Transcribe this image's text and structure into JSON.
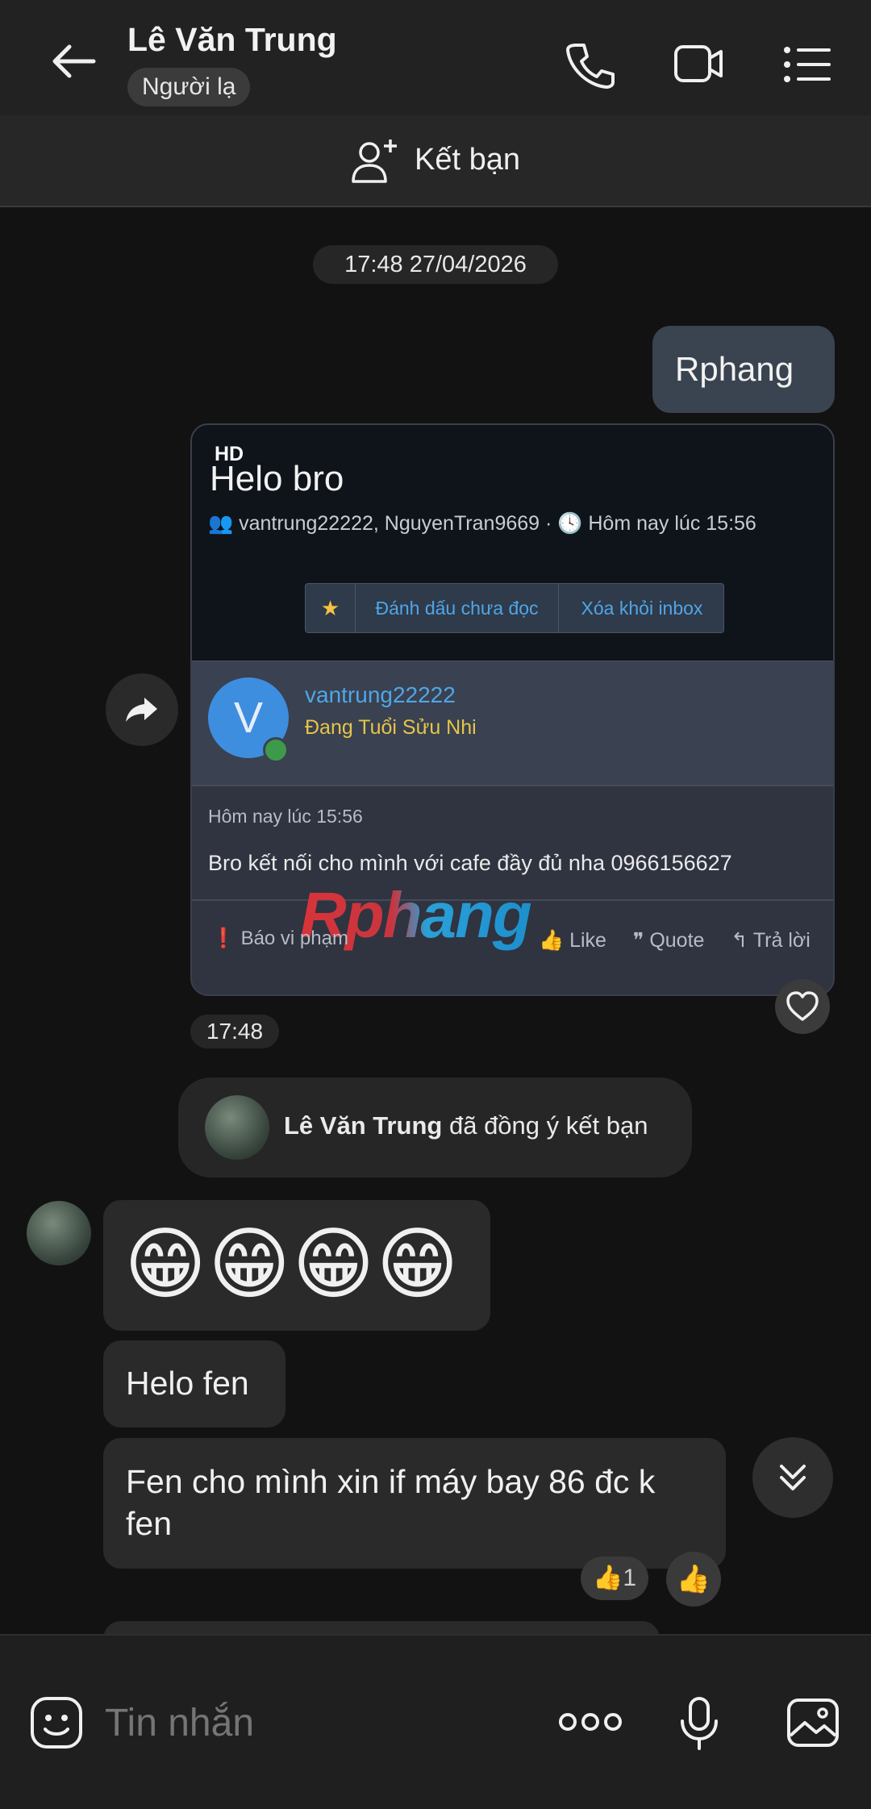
{
  "header": {
    "contact_name": "Lê Văn Trung",
    "badge": "Người lạ",
    "icons": [
      "back-arrow-icon",
      "phone-icon",
      "video-call-icon",
      "list-menu-icon"
    ]
  },
  "add_friend": {
    "label": "Kết bạn"
  },
  "timestamp_top": "17:48 27/04/2026",
  "my_message": "Rphang",
  "forwarded_image": {
    "hd_label": "HD",
    "title": "Helo bro",
    "participants": "vantrung22222, NguyenTran9669 · ",
    "time": "Hôm nay lúc 15:56",
    "actions": [
      "Đánh dấu chưa đọc",
      "Xóa khỏi inbox"
    ],
    "avatar_letter": "V",
    "username": "vantrung22222",
    "user_title": "Đang Tuổi Sửu Nhi",
    "post_time": "Hôm nay lúc 15:56",
    "post_text": "Bro kết nối cho mình với cafe đầy đủ nha 0966156627",
    "watermark": "Rphang",
    "report": "Báo vi phạm",
    "like": "Like",
    "quote": "Quote",
    "reply": "Trả lời"
  },
  "image_time": "17:48",
  "system_message": {
    "name": "Lê Văn Trung",
    "text": " đã đồng ý kết bạn"
  },
  "messages": [
    {
      "text": "😁😁😁😁"
    },
    {
      "text": "Helo fen"
    },
    {
      "text_line1": "Fen cho mình xin if máy bay 86 đc k",
      "text_line2": "fen"
    }
  ],
  "reaction": {
    "emoji": "👍",
    "count": "1",
    "quick_emoji": "👍"
  },
  "input": {
    "placeholder": "Tin nhắn"
  }
}
